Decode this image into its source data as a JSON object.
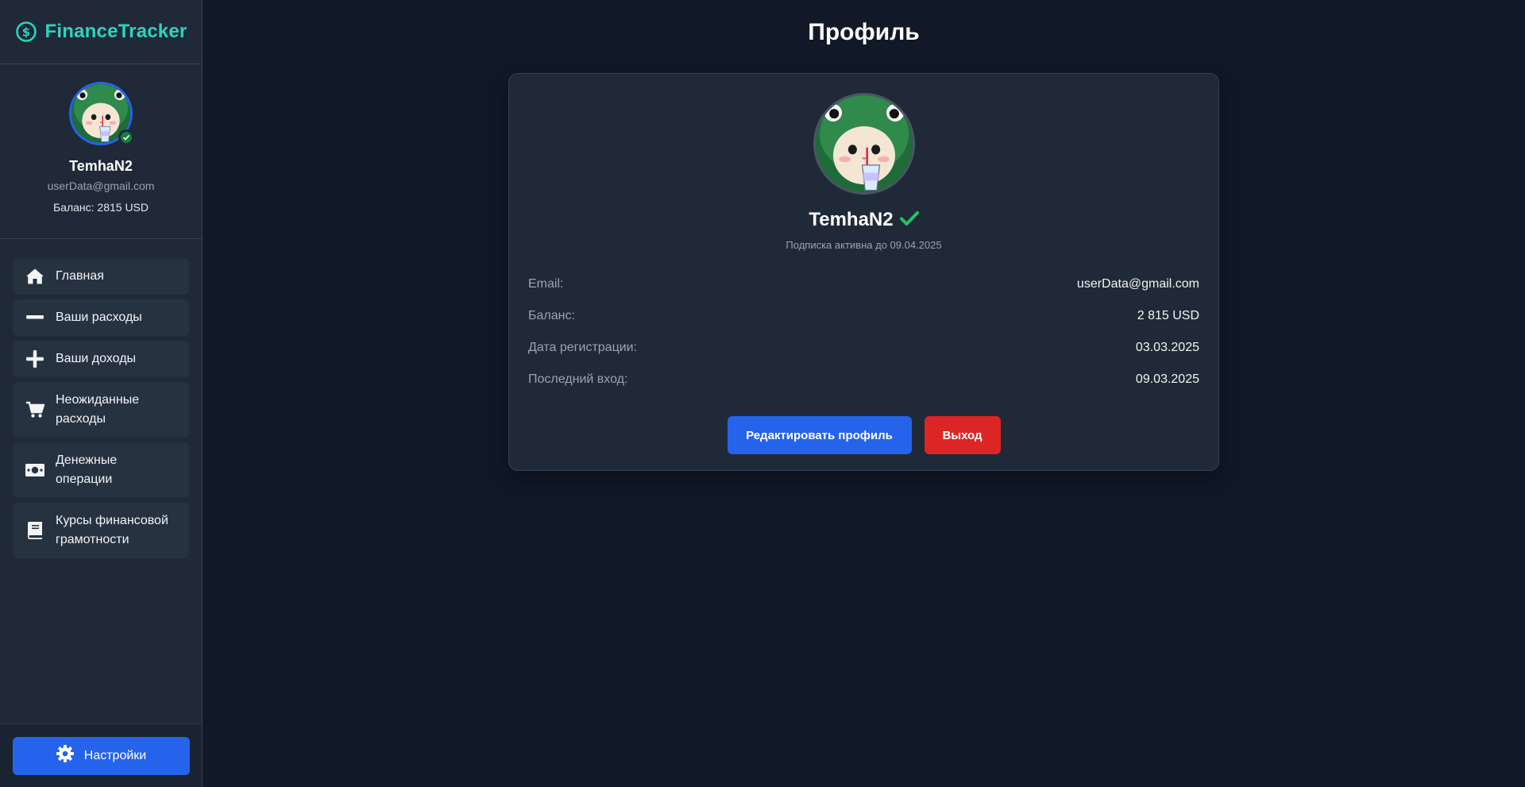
{
  "brand": {
    "name": "FinanceTracker",
    "icon": "dollar-circle-icon",
    "color": "#2dd4bf"
  },
  "user": {
    "name": "TemhaN2",
    "email": "userData@gmail.com",
    "balance_label": "Баланс: 2815 USD",
    "online": true
  },
  "nav": {
    "items": [
      {
        "label": "Главная",
        "icon": "home-icon"
      },
      {
        "label": "Ваши расходы",
        "icon": "minus-icon"
      },
      {
        "label": "Ваши доходы",
        "icon": "plus-icon"
      },
      {
        "label": "Неожиданные расходы",
        "icon": "shopping-cart-icon"
      },
      {
        "label": "Денежные операции",
        "icon": "money-bill-icon"
      },
      {
        "label": "Курсы финансовой грамотности",
        "icon": "book-icon"
      }
    ]
  },
  "settings": {
    "label": "Настройки",
    "icon": "gear-icon"
  },
  "page": {
    "title": "Профиль"
  },
  "profile": {
    "name": "TemhaN2",
    "verified": true,
    "subscription": "Подписка активна до 09.04.2025",
    "rows": [
      {
        "label": "Email:",
        "value": "userData@gmail.com"
      },
      {
        "label": "Баланс:",
        "value": "2 815 USD"
      },
      {
        "label": "Дата регистрации:",
        "value": "03.03.2025"
      },
      {
        "label": "Последний вход:",
        "value": "09.03.2025"
      }
    ],
    "edit_label": "Редактировать профиль",
    "logout_label": "Выход"
  },
  "colors": {
    "accent": "#2563eb",
    "danger": "#dc2626",
    "success": "#22c55e",
    "background": "#111827",
    "surface": "#1f2937"
  }
}
